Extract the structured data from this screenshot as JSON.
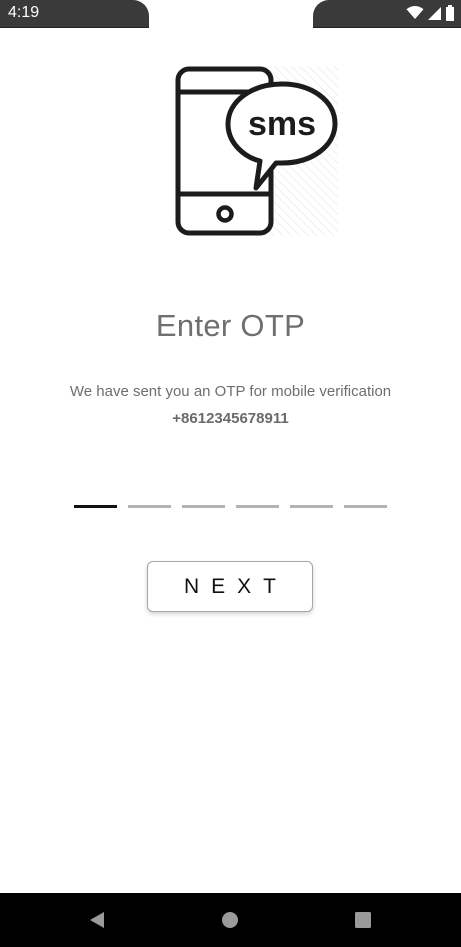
{
  "status_bar": {
    "time": "4:19",
    "icons": [
      "wifi-icon",
      "signal-icon",
      "battery-icon"
    ]
  },
  "illustration": {
    "label": "sms"
  },
  "otp": {
    "title": "Enter OTP",
    "message": "We have sent you an OTP for mobile verification",
    "phone_number": "+8612345678911",
    "slot_count": 6,
    "active_slot": 1
  },
  "actions": {
    "next_label": "NEXT"
  },
  "nav_bar": {
    "buttons": [
      "back-icon",
      "home-icon",
      "recents-icon"
    ]
  },
  "colors": {
    "status_bar": "#3a3a3a",
    "nav_bar": "#000000",
    "title_text": "#6f6f6f",
    "otp_active": "#111111",
    "otp_inactive": "#b3b3b3"
  }
}
